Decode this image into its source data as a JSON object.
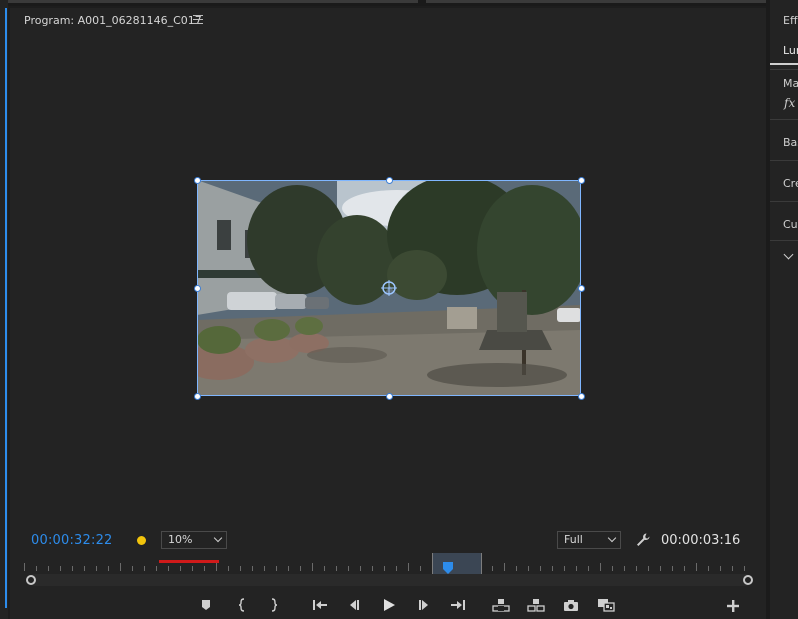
{
  "program_monitor": {
    "title": "Program: A001_06281146_C017",
    "current_timecode": "00:00:32:22",
    "zoom_level": "10%",
    "resolution": "Full",
    "duration_timecode": "00:00:03:16"
  },
  "icons": {
    "panel_menu": "hamburger-icon",
    "settings": "wrench-icon",
    "anchor": "anchor-point-icon",
    "add": "plus-icon"
  },
  "transport": [
    {
      "name": "add-marker-button",
      "icon": "marker-icon"
    },
    {
      "name": "mark-in-button",
      "icon": "mark-in-icon"
    },
    {
      "name": "mark-out-button",
      "icon": "mark-out-icon"
    },
    {
      "name": "go-to-in-button",
      "icon": "go-to-in-icon"
    },
    {
      "name": "step-back-button",
      "icon": "step-back-icon"
    },
    {
      "name": "play-button",
      "icon": "play-icon"
    },
    {
      "name": "step-forward-button",
      "icon": "step-forward-icon"
    },
    {
      "name": "go-to-out-button",
      "icon": "go-to-out-icon"
    },
    {
      "name": "lift-button",
      "icon": "lift-icon"
    },
    {
      "name": "extract-button",
      "icon": "extract-icon"
    },
    {
      "name": "export-frame-button",
      "icon": "camera-icon"
    },
    {
      "name": "comparison-view-button",
      "icon": "compare-icon"
    }
  ],
  "lumetri_panel": {
    "tab_effects": "Effe",
    "tab_lumetri": "Lun",
    "master_label": "Ma",
    "fx_label": "fx",
    "section_basic": "Bas",
    "section_creative": "Cre",
    "section_curves": "Cur"
  },
  "colors": {
    "accent_blue": "#2d8ceb",
    "marker_yellow": "#f2c40c",
    "render_bar_red": "#d01a1a"
  }
}
